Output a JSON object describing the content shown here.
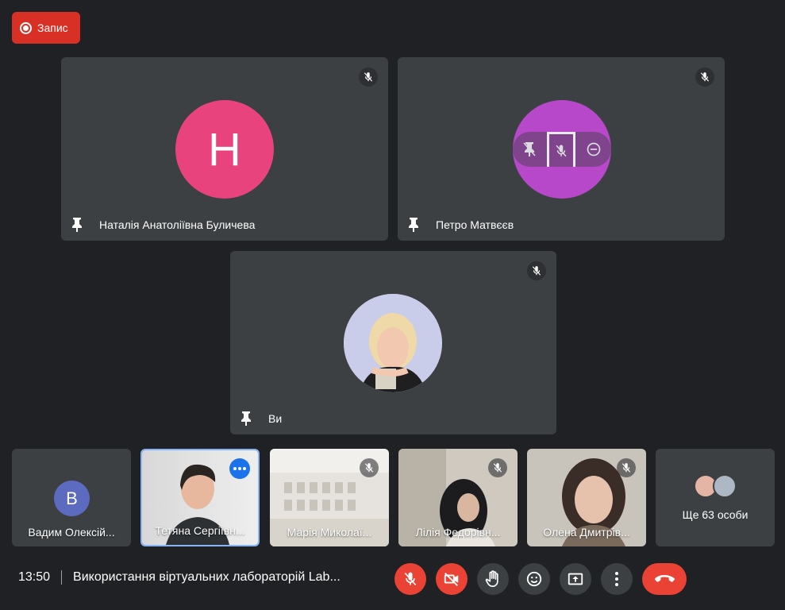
{
  "recording": {
    "label": "Запис"
  },
  "main_tiles": [
    {
      "name": "Наталія Анатоліївна Буличева",
      "initial": "Н",
      "avatar_color": "#e8437d"
    },
    {
      "name": "Петро Матвєєв",
      "avatar_color": "#b748c9"
    },
    {
      "name": "Ви"
    }
  ],
  "strip": [
    {
      "name": "Вадим Олексій...",
      "initial": "В",
      "avatar_color": "#5c6bc0"
    },
    {
      "name": "Тетяна Сергіївн..."
    },
    {
      "name": "Марія Миколаї..."
    },
    {
      "name": "Лілія Федорівн..."
    },
    {
      "name": "Олена Дмитрів..."
    },
    {
      "name": "Ще 63 особи"
    }
  ],
  "footer": {
    "time": "13:50",
    "meeting_title": "Використання віртуальних лабораторій Lab..."
  },
  "colors": {
    "background": "#202124",
    "tile": "#3c4043",
    "danger": "#ea4335",
    "active_border": "#8ab4f8"
  },
  "icons": [
    "record-icon",
    "pin-icon",
    "mic-off-icon",
    "camera-off-icon",
    "raise-hand-icon",
    "emoji-icon",
    "present-icon",
    "more-options-icon",
    "end-call-icon"
  ]
}
